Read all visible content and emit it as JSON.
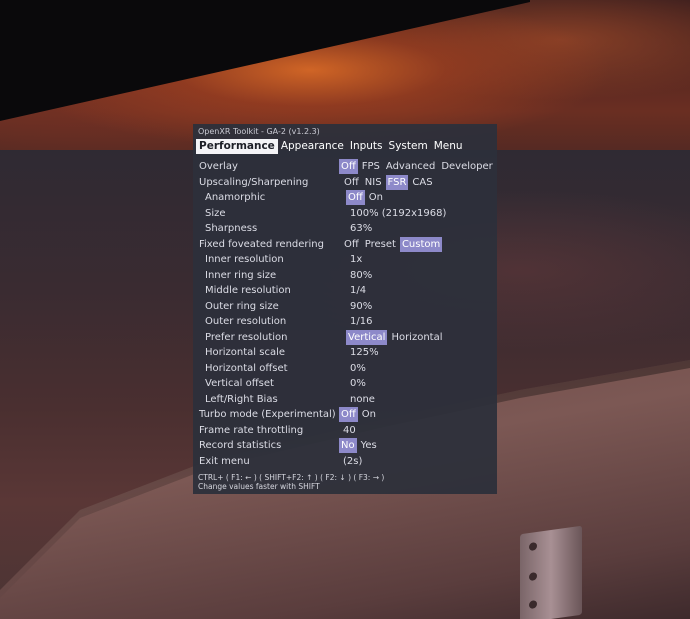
{
  "window": {
    "title": "OpenXR Toolkit - GA-2 (v1.2.3)"
  },
  "tabs": [
    {
      "label": "Performance",
      "active": true
    },
    {
      "label": "Appearance",
      "active": false
    },
    {
      "label": "Inputs",
      "active": false
    },
    {
      "label": "System",
      "active": false
    },
    {
      "label": "Menu",
      "active": false
    }
  ],
  "settings": {
    "overlay": {
      "label": "Overlay",
      "options": [
        "Off",
        "FPS",
        "Advanced",
        "Developer"
      ],
      "selected": "Off"
    },
    "upscaling": {
      "label": "Upscaling/Sharpening",
      "options": [
        "Off",
        "NIS",
        "FSR",
        "CAS"
      ],
      "selected": "FSR"
    },
    "anamorphic": {
      "label": "Anamorphic",
      "options": [
        "Off",
        "On"
      ],
      "selected": "Off"
    },
    "size": {
      "label": "Size",
      "value": "100% (2192x1968)"
    },
    "sharpness": {
      "label": "Sharpness",
      "value": "63%"
    },
    "ffr": {
      "label": "Fixed foveated rendering",
      "options": [
        "Off",
        "Preset",
        "Custom"
      ],
      "selected": "Custom"
    },
    "inner_resolution": {
      "label": "Inner resolution",
      "value": "1x"
    },
    "inner_ring_size": {
      "label": "Inner ring size",
      "value": "80%"
    },
    "middle_resolution": {
      "label": "Middle resolution",
      "value": "1/4"
    },
    "outer_ring_size": {
      "label": "Outer ring size",
      "value": "90%"
    },
    "outer_resolution": {
      "label": "Outer resolution",
      "value": "1/16"
    },
    "prefer_resolution": {
      "label": "Prefer resolution",
      "options": [
        "Vertical",
        "Horizontal"
      ],
      "selected": "Vertical"
    },
    "horizontal_scale": {
      "label": "Horizontal scale",
      "value": "125%"
    },
    "horizontal_offset": {
      "label": "Horizontal offset",
      "value": "0%"
    },
    "vertical_offset": {
      "label": "Vertical offset",
      "value": "0%"
    },
    "lr_bias": {
      "label": "Left/Right Bias",
      "value": "none"
    },
    "turbo_mode": {
      "label": "Turbo mode (Experimental)",
      "options": [
        "Off",
        "On"
      ],
      "selected": "Off"
    },
    "frame_rate_throttling": {
      "label": "Frame rate throttling",
      "value": "40"
    },
    "record_statistics": {
      "label": "Record statistics",
      "options": [
        "No",
        "Yes"
      ],
      "selected": "No"
    },
    "exit_menu": {
      "label": "Exit menu",
      "value": "(2s)"
    }
  },
  "hints": {
    "shortcuts": "CTRL+ ( F1: ← ) ( SHIFT+F2: ↑ ) ( F2: ↓ ) ( F3: → )",
    "faster": "Change values faster with SHIFT"
  },
  "colors": {
    "panel_bg": "#2d303a",
    "selected_option": "#8d89c9",
    "active_tab": "#f4f4f7"
  }
}
